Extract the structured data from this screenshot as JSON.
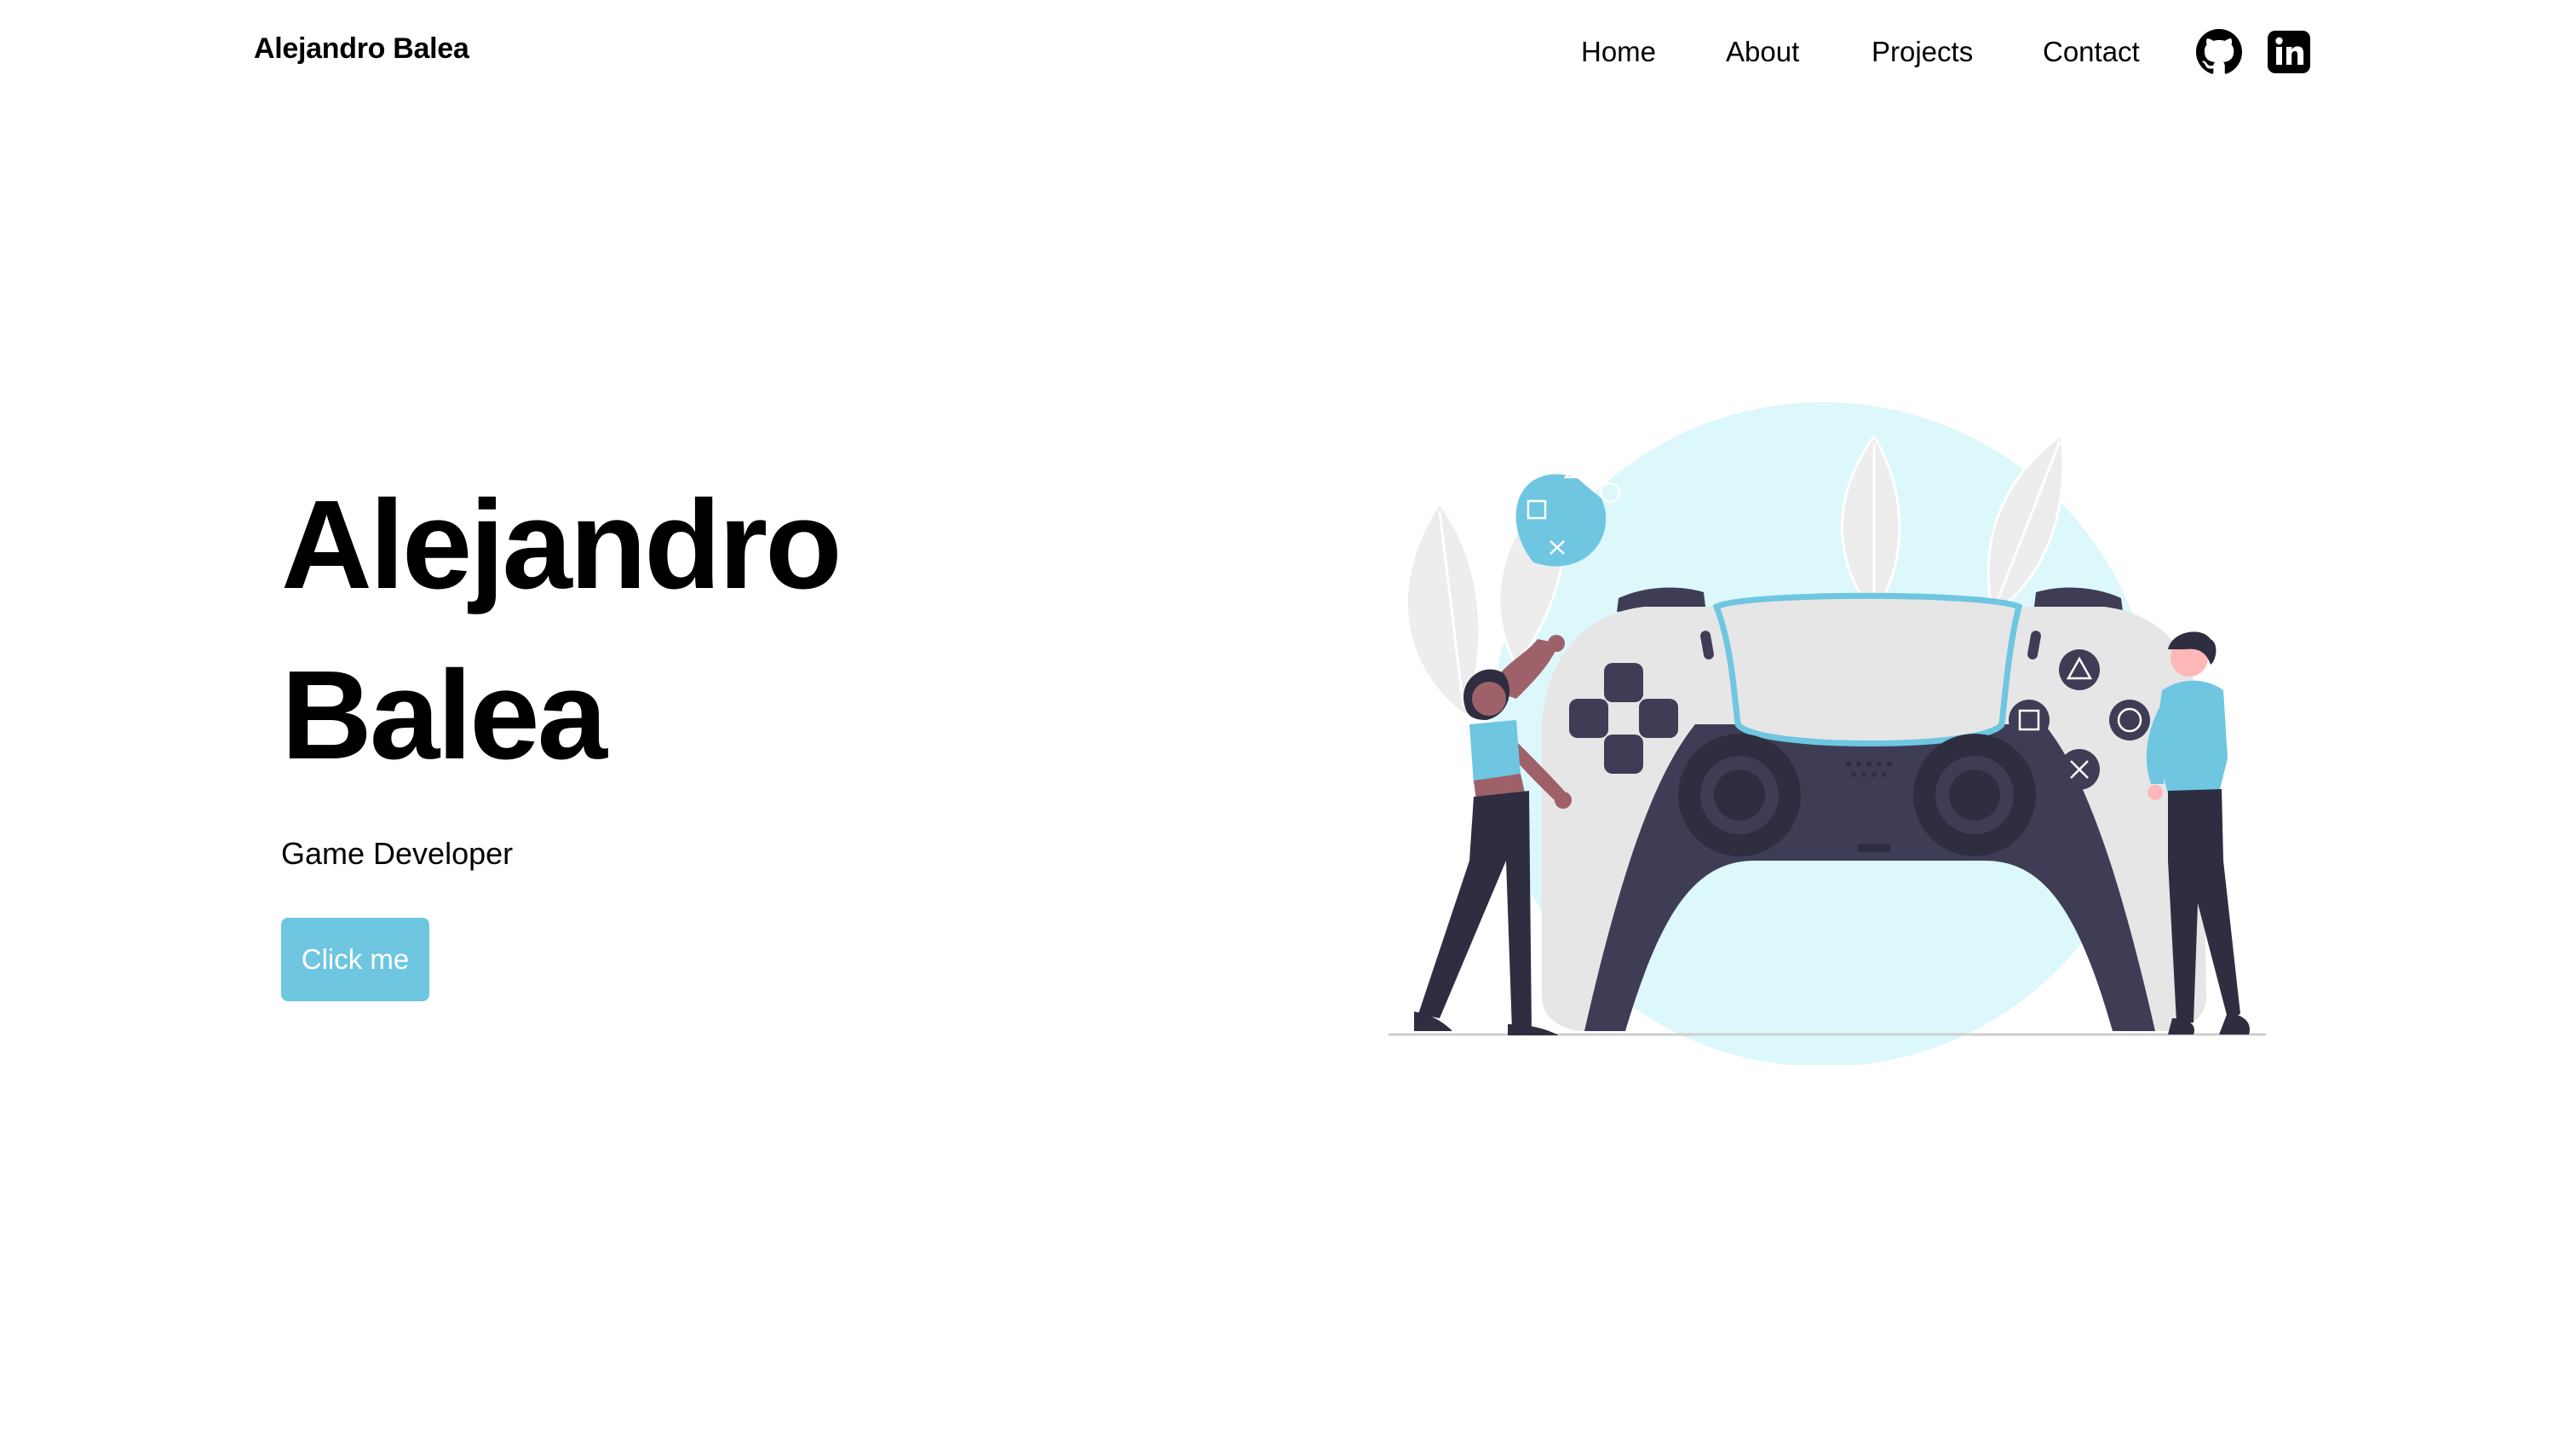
{
  "nav": {
    "brand": "Alejandro Balea",
    "links": [
      "Home",
      "About",
      "Projects",
      "Contact"
    ],
    "social": [
      {
        "icon": "github-icon"
      },
      {
        "icon": "linkedin-icon"
      }
    ]
  },
  "hero": {
    "title_line1": "Alejandro",
    "title_line2": "Balea",
    "subtitle": "Game Developer",
    "button_label": "Click me",
    "button_color": "#6ec6e1"
  },
  "illustration": {
    "subject": "gamepad-illustration",
    "accent": "#6ec6e1",
    "circle_color": "#dcf8fa",
    "dark_color": "#3f3d56"
  }
}
